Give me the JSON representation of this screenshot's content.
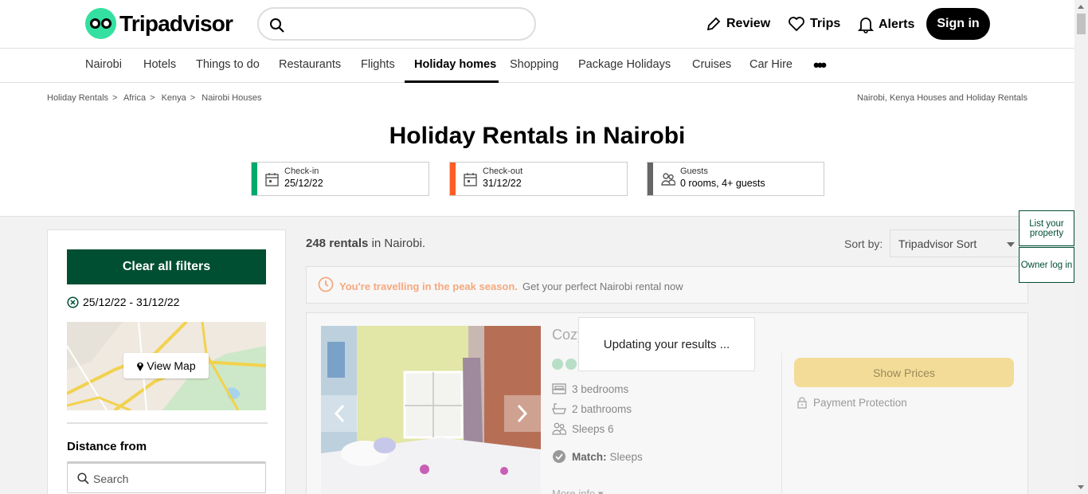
{
  "header": {
    "logo_text": "Tripadvisor",
    "review": "Review",
    "trips": "Trips",
    "alerts": "Alerts",
    "sign_in": "Sign in"
  },
  "nav": {
    "items": [
      "Nairobi",
      "Hotels",
      "Things to do",
      "Restaurants",
      "Flights",
      "Holiday homes",
      "Shopping",
      "Package Holidays",
      "Cruises",
      "Car Hire"
    ],
    "active": "Holiday homes",
    "more": "•••"
  },
  "breadcrumb": {
    "items": [
      "Holiday Rentals",
      "Africa",
      "Kenya",
      "Nairobi Houses"
    ],
    "right": "Nairobi, Kenya Houses and Holiday Rentals"
  },
  "page_title": "Holiday Rentals in Nairobi",
  "pickers": {
    "checkin": {
      "label": "Check-in",
      "value": "25/12/22",
      "color": "#00aa6c"
    },
    "checkout": {
      "label": "Check-out",
      "value": "31/12/22",
      "color": "#ff5d25"
    },
    "guests": {
      "label": "Guests",
      "value": "0 rooms, 4+ guests",
      "color": "#666666"
    }
  },
  "sidebar": {
    "clear_filters": "Clear all filters",
    "date_range": "25/12/22 - 31/12/22",
    "view_map": "View Map",
    "distance_heading": "Distance from",
    "search_placeholder": "Search"
  },
  "results": {
    "count": "248 rentals",
    "location": "in Nairobi.",
    "sort_label": "Sort by:",
    "sort_value": "Tripadvisor Sort"
  },
  "peak_banner": {
    "highlight": "You're travelling in the peak season.",
    "text": "Get your perfect Nairobi rental now"
  },
  "listing": {
    "title": "Cozy Rooms - IKIA",
    "bedrooms": "3 bedrooms",
    "bathrooms": "2 bathrooms",
    "sleeps": "Sleeps 6",
    "match_label": "Match:",
    "match_value": "Sleeps",
    "more_info": "More info",
    "show_prices": "Show Prices",
    "payment_protection": "Payment Protection"
  },
  "overlay": {
    "updating": "Updating your results ..."
  },
  "floating": {
    "list_property": "List your property",
    "owner_login": "Owner log in"
  },
  "colors": {
    "brand_green": "#004f32",
    "logo_green": "#34e0a1"
  }
}
